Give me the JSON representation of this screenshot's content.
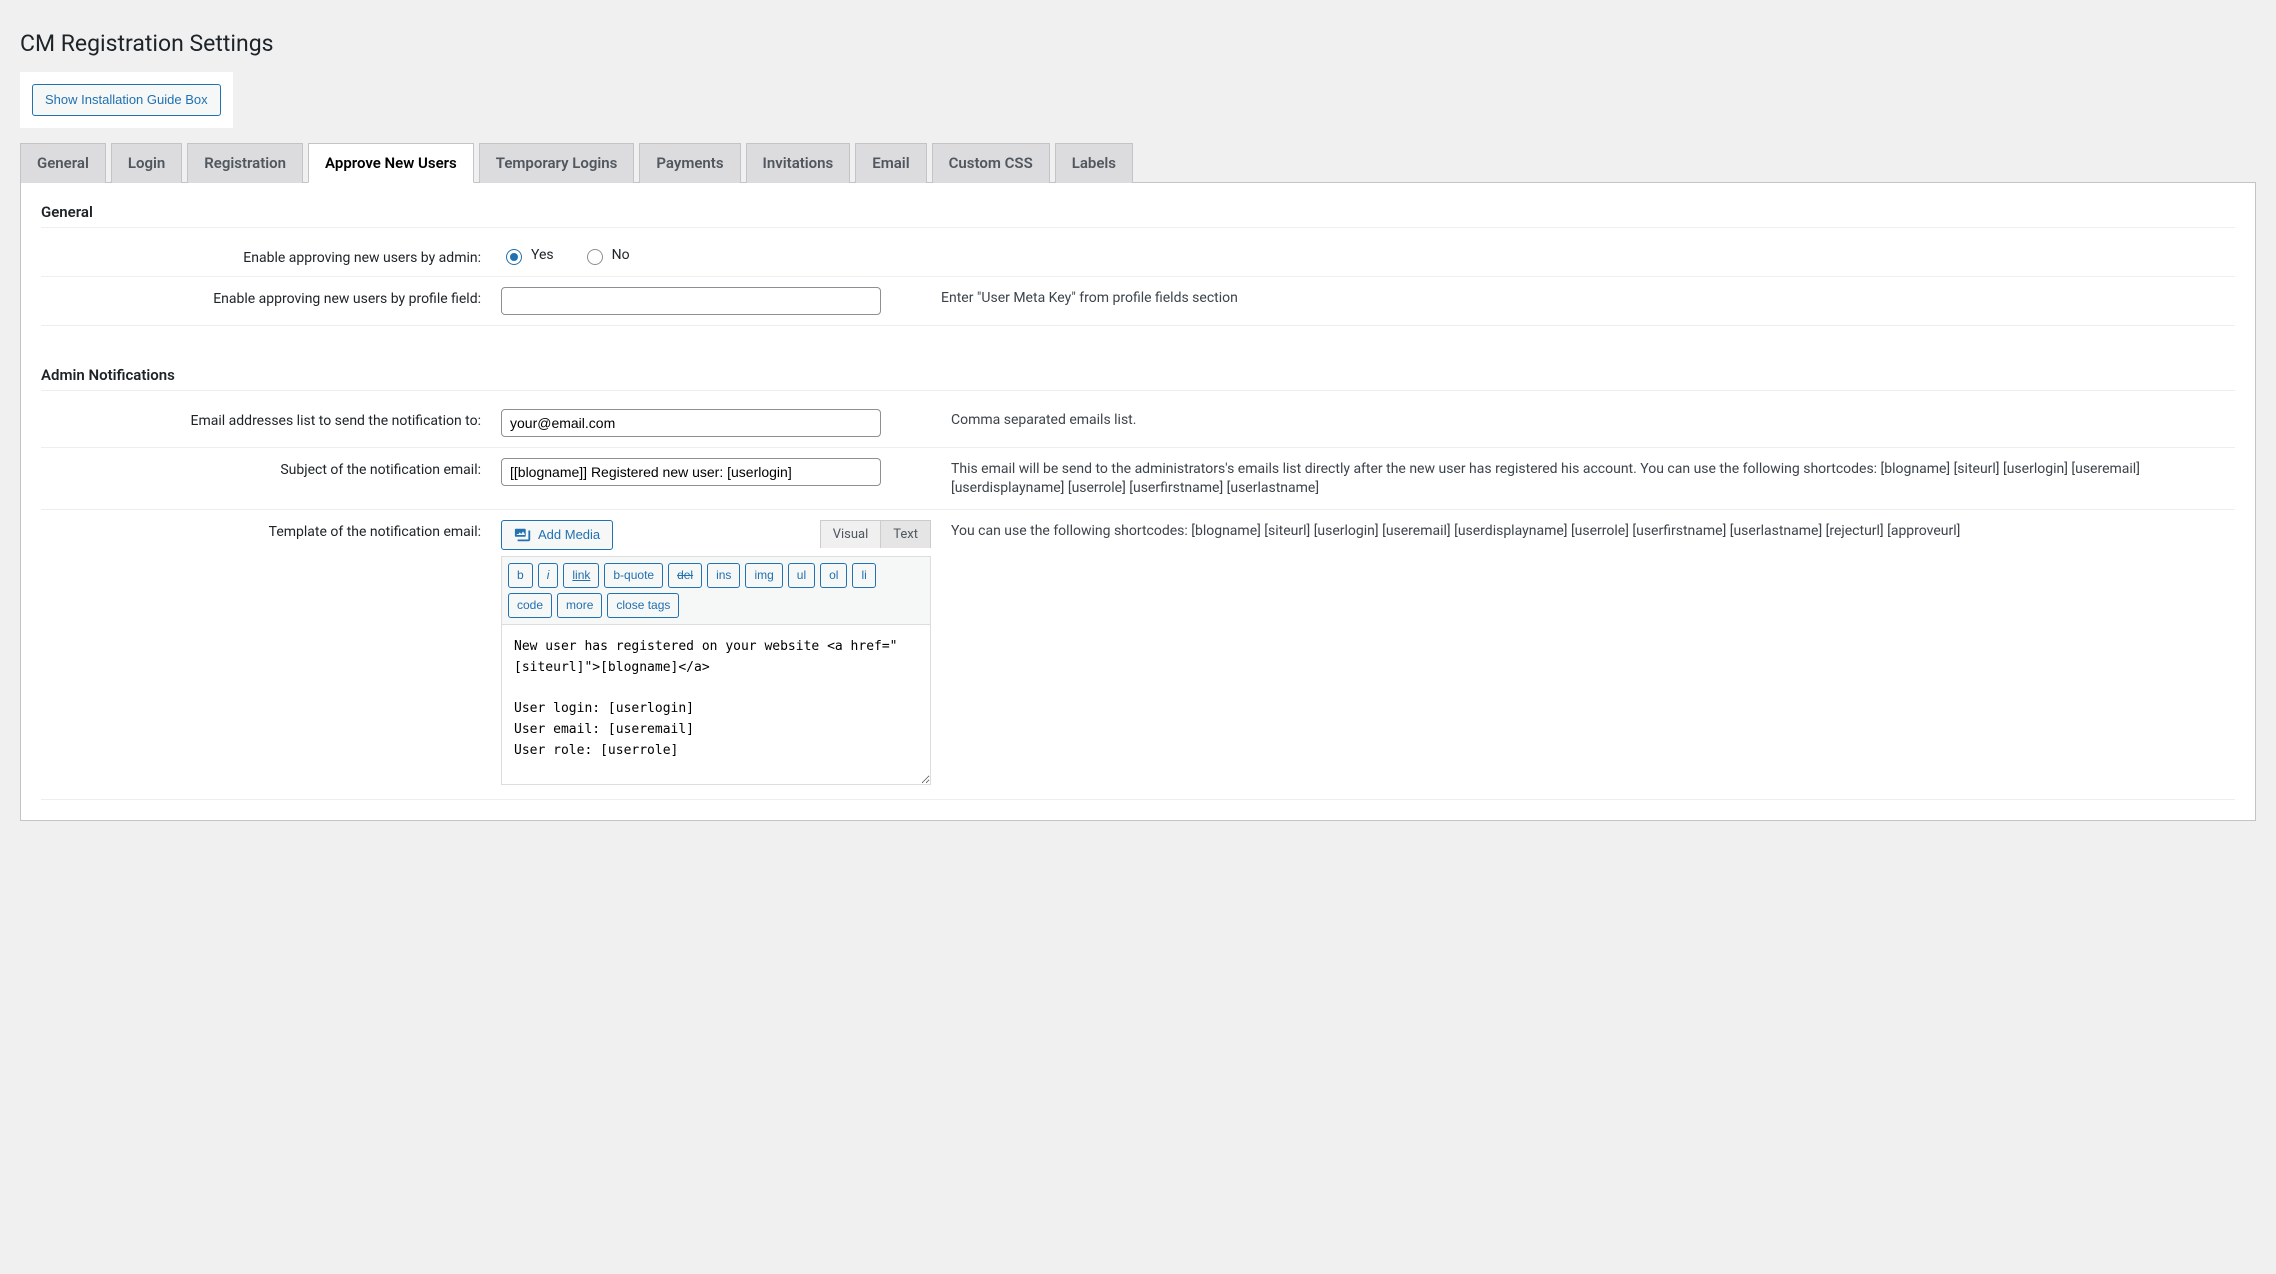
{
  "pageTitle": "CM Registration Settings",
  "guideButton": "Show Installation Guide Box",
  "tabs": [
    {
      "label": "General"
    },
    {
      "label": "Login"
    },
    {
      "label": "Registration"
    },
    {
      "label": "Approve New Users"
    },
    {
      "label": "Temporary Logins"
    },
    {
      "label": "Payments"
    },
    {
      "label": "Invitations"
    },
    {
      "label": "Email"
    },
    {
      "label": "Custom CSS"
    },
    {
      "label": "Labels"
    }
  ],
  "sections": {
    "general": {
      "heading": "General",
      "enableApproveLabel": "Enable approving new users by admin:",
      "yes": "Yes",
      "no": "No",
      "enableProfileLabel": "Enable approving new users by profile field:",
      "enableProfileValue": "",
      "enableProfileDesc": "Enter \"User Meta Key\" from profile fields section"
    },
    "admin": {
      "heading": "Admin Notifications",
      "emailsLabel": "Email addresses list to send the notification to:",
      "emailsValue": "your@email.com",
      "emailsDesc": "Comma separated emails list.",
      "subjectLabel": "Subject of the notification email:",
      "subjectValue": "[[blogname]] Registered new user: [userlogin]",
      "subjectDesc": "This email will be send to the administrators's emails list directly after the new user has registered his account. You can use the following shortcodes: [blogname] [siteurl] [userlogin] [useremail] [userdisplayname] [userrole] [userfirstname] [userlastname]",
      "templateLabel": "Template of the notification email:",
      "templateDesc": "You can use the following shortcodes: [blogname] [siteurl] [userlogin] [useremail] [userdisplayname] [userrole] [userfirstname] [userlastname] [rejecturl] [approveurl]"
    }
  },
  "editor": {
    "addMedia": "Add Media",
    "tabVisual": "Visual",
    "tabText": "Text",
    "qt": {
      "b": "b",
      "i": "i",
      "link": "link",
      "bquote": "b-quote",
      "del": "del",
      "ins": "ins",
      "img": "img",
      "ul": "ul",
      "ol": "ol",
      "li": "li",
      "code": "code",
      "more": "more",
      "close": "close tags"
    },
    "content": "New user has registered on your website <a href=\"[siteurl]\">[blogname]</a>\n\nUser login: [userlogin]\nUser email: [useremail]\nUser role: [userrole]\n\nYou can: <a href=\"[approveurl]\">APPROVE</a> or <a"
  }
}
